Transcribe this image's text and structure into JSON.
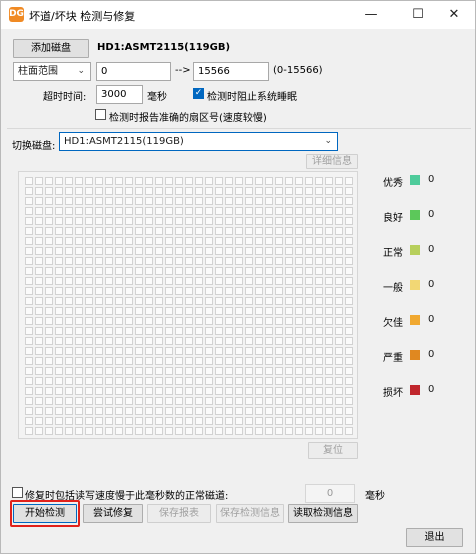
{
  "window": {
    "title": "坏道/坏块 检测与修复",
    "app_icon_text": "DG",
    "minimize_icon": "minimize-icon",
    "maximize_icon": "maximize-icon",
    "close_icon": "close-icon"
  },
  "header": {
    "add_disk_label": "添加磁盘",
    "disk_name": "HD1:ASMT2115(119GB)"
  },
  "range": {
    "mode_selected": "柱面范围",
    "start_value": "0",
    "arrow": "-->",
    "end_value": "15566",
    "range_hint": "(0-15566)"
  },
  "timeout": {
    "label": "超时时间:",
    "value": "3000",
    "unit": "毫秒",
    "prevent_sleep_label": "检测时阻止系统睡眠",
    "prevent_sleep_checked": true,
    "report_sector_label": "检测时报告准确的扇区号(速度较慢)",
    "report_sector_checked": false
  },
  "switch_disk": {
    "label": "切换磁盘:",
    "selected": "HD1:ASMT2115(119GB)"
  },
  "detail_button": "详细信息",
  "reset_button": "复位",
  "legend": [
    {
      "label": "优秀",
      "color": "#4ecb9b",
      "count": "0"
    },
    {
      "label": "良好",
      "color": "#5cc85a",
      "count": "0"
    },
    {
      "label": "正常",
      "color": "#b7cf5c",
      "count": "0"
    },
    {
      "label": "一般",
      "color": "#f2d774",
      "count": "0"
    },
    {
      "label": "欠佳",
      "color": "#f0a830",
      "count": "0"
    },
    {
      "label": "严重",
      "color": "#e08820",
      "count": "0"
    },
    {
      "label": "损坏",
      "color": "#c0262d",
      "count": "0"
    }
  ],
  "repair_option": {
    "label": "修复时包括读写速度慢于此毫秒数的正常磁道:",
    "checked": false,
    "value": "0",
    "unit": "毫秒"
  },
  "actions": {
    "start_check": "开始检测",
    "try_repair": "尝试修复",
    "save_report": "保存报表",
    "save_check_info": "保存检测信息",
    "read_check_info": "读取检测信息",
    "exit": "退出"
  }
}
